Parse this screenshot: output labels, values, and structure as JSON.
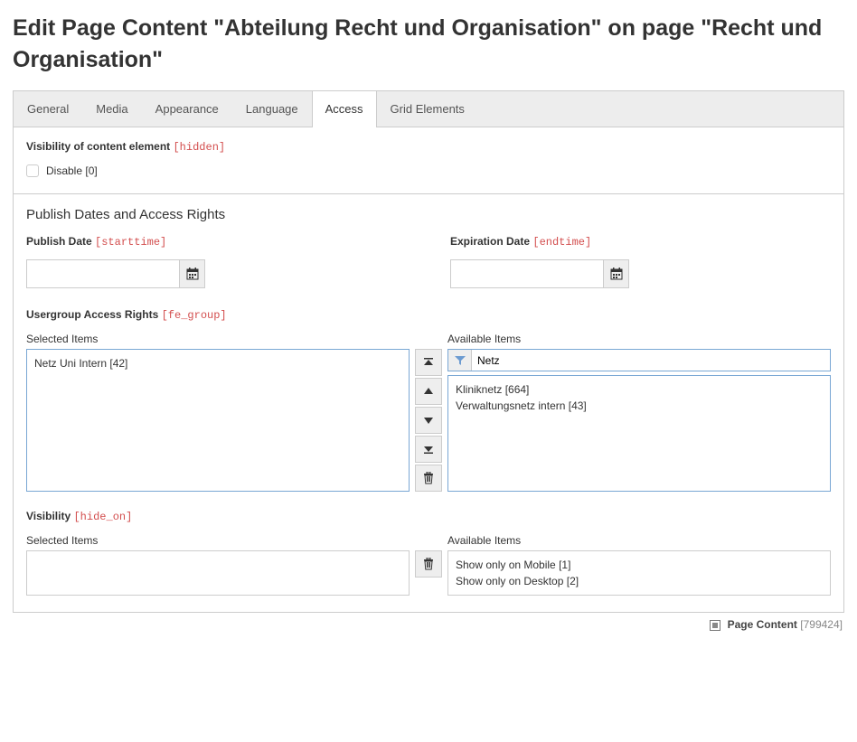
{
  "header": {
    "title": "Edit Page Content \"Abteilung Recht und Organisation\" on page \"Recht und Organisation\""
  },
  "tabs": [
    {
      "label": "General",
      "active": false
    },
    {
      "label": "Media",
      "active": false
    },
    {
      "label": "Appearance",
      "active": false
    },
    {
      "label": "Language",
      "active": false
    },
    {
      "label": "Access",
      "active": true
    },
    {
      "label": "Grid Elements",
      "active": false
    }
  ],
  "visibility_section": {
    "label": "Visibility of content element",
    "tech": "[hidden]",
    "checkbox_label": "Disable [0]"
  },
  "publish_section": {
    "heading": "Publish Dates and Access Rights",
    "publish_date": {
      "label": "Publish Date",
      "tech": "[starttime]",
      "value": ""
    },
    "expiration_date": {
      "label": "Expiration Date",
      "tech": "[endtime]",
      "value": ""
    }
  },
  "usergroup": {
    "label": "Usergroup Access Rights",
    "tech": "[fe_group]",
    "selected_label": "Selected Items",
    "available_label": "Available Items",
    "filter_value": "Netz",
    "selected_items": [
      "Netz Uni Intern [42]"
    ],
    "available_items": [
      "Kliniknetz [664]",
      "Verwaltungsnetz intern [43]"
    ]
  },
  "hideon": {
    "label": "Visibility",
    "tech": "[hide_on]",
    "selected_label": "Selected Items",
    "available_label": "Available Items",
    "selected_items": [],
    "available_items": [
      "Show only on Mobile [1]",
      "Show only on Desktop [2]"
    ]
  },
  "footer": {
    "type_label": "Page Content",
    "uid": "[799424]"
  }
}
